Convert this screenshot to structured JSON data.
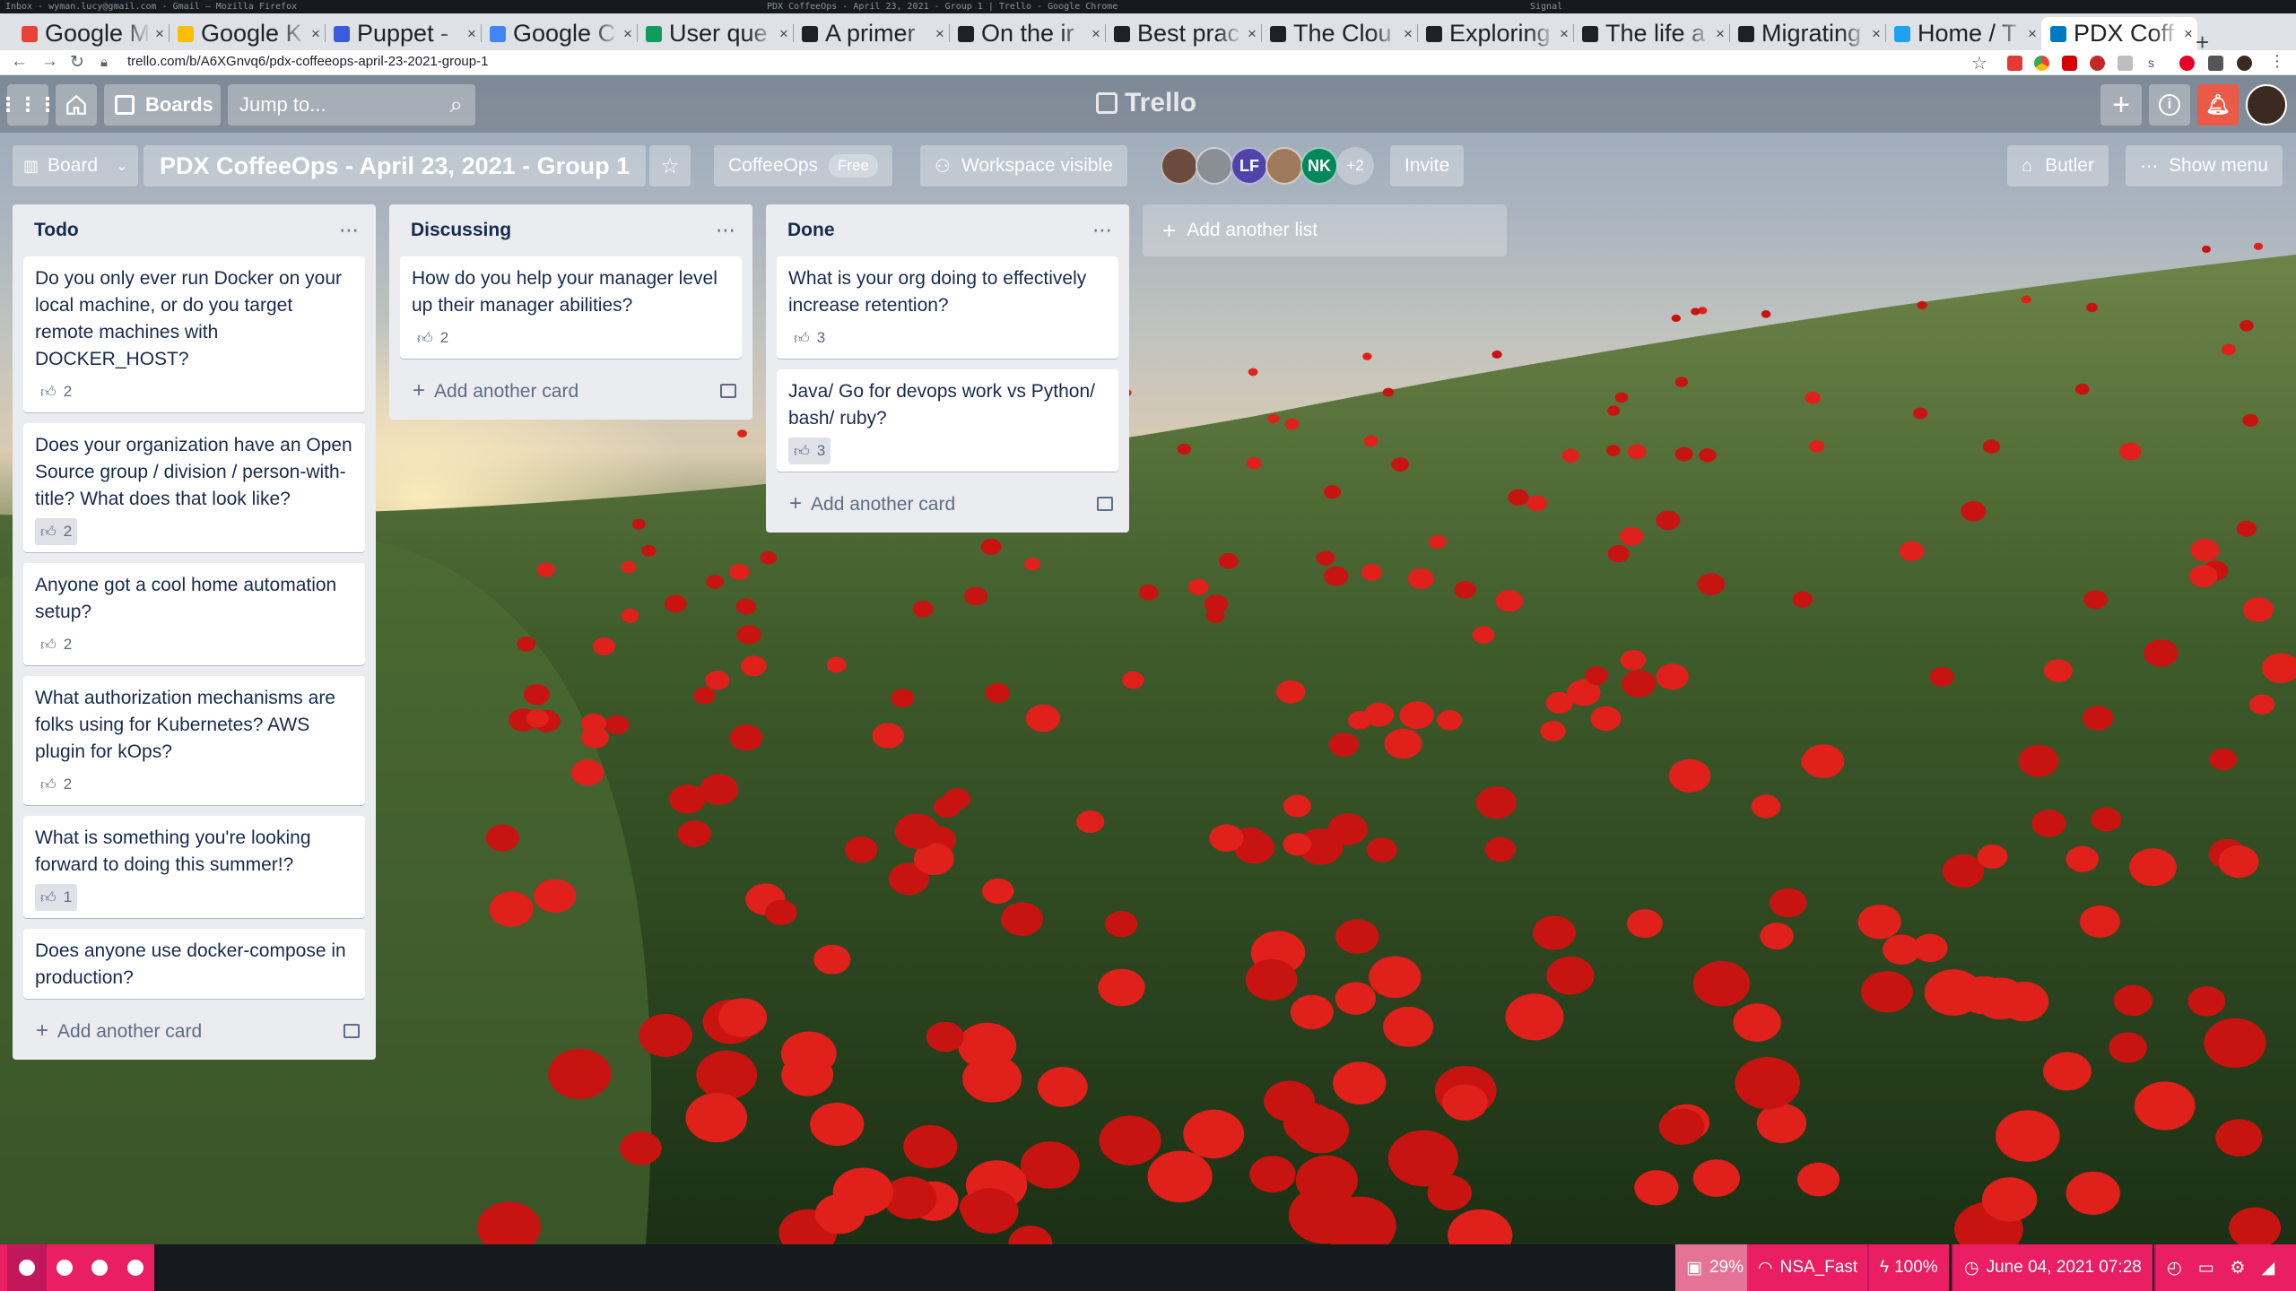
{
  "os_top": {
    "left_text": "Inbox - wyman.lucy@gmail.com - Gmail — Mozilla Firefox",
    "center_text": "PDX CoffeeOps - April 23, 2021 - Group 1 | Trello - Google Chrome",
    "right_text": "Signal"
  },
  "tabs": [
    {
      "title": "Google M",
      "fav_color": "#ea4335"
    },
    {
      "title": "Google K",
      "fav_color": "#fbbc04"
    },
    {
      "title": "Puppet - ",
      "fav_color": "#3b5bdb"
    },
    {
      "title": "Google C",
      "fav_color": "#4285f4"
    },
    {
      "title": "User que",
      "fav_color": "#0f9d58"
    },
    {
      "title": "A primer",
      "fav_color": "#202124"
    },
    {
      "title": "On the ir",
      "fav_color": "#202124"
    },
    {
      "title": "Best prac",
      "fav_color": "#202124"
    },
    {
      "title": "The Clou",
      "fav_color": "#202124"
    },
    {
      "title": "Exploring",
      "fav_color": "#202124"
    },
    {
      "title": "The life a",
      "fav_color": "#202124"
    },
    {
      "title": "Migrating",
      "fav_color": "#202124"
    },
    {
      "title": "Home / T",
      "fav_color": "#1da1f2"
    },
    {
      "title": "PDX Coff",
      "fav_color": "#0079bf"
    }
  ],
  "new_tab": "+",
  "address": "trello.com/b/A6XGnvq6/pdx-coffeeops-april-23-2021-group-1",
  "trello_header": {
    "boards": "Boards",
    "search_placeholder": "Jump to...",
    "logo": "Trello"
  },
  "board": {
    "view": "Board",
    "title": "PDX CoffeeOps - April 23, 2021 - Group 1",
    "workspace": "CoffeeOps",
    "plan": "Free",
    "visibility": "Workspace visible",
    "members": [
      {
        "initials": "",
        "color": "#6b4b3e"
      },
      {
        "initials": "",
        "color": "#8a8f96"
      },
      {
        "initials": "LF",
        "color": "#5243aa"
      },
      {
        "initials": "",
        "color": "#a07a5c"
      },
      {
        "initials": "NK",
        "color": "#00875a"
      }
    ],
    "more_members": "+2",
    "invite": "Invite",
    "butler": "Butler",
    "show_menu": "Show menu",
    "add_list": "Add another list"
  },
  "add_card_label": "Add another card",
  "lists": [
    {
      "title": "Todo",
      "cards": [
        {
          "text": "Do you only ever run Docker on your local machine, or do you target remote machines with DOCKER_HOST?",
          "votes": "2",
          "voted": false
        },
        {
          "text": "Does your organization have an Open Source group / division / person-with-title? What does that look like?",
          "votes": "2",
          "voted": true
        },
        {
          "text": "Anyone got a cool home automation setup?",
          "votes": "2",
          "voted": false
        },
        {
          "text": "What authorization mechanisms are folks using for Kubernetes? AWS plugin for kOps?",
          "votes": "2",
          "voted": false
        },
        {
          "text": "What is something you're looking forward to doing this summer!?",
          "votes": "1",
          "voted": true
        },
        {
          "text": "Does anyone use docker-compose in production?",
          "votes": "",
          "voted": false
        }
      ]
    },
    {
      "title": "Discussing",
      "cards": [
        {
          "text": "How do you help your manager level up their manager abilities?",
          "votes": "2",
          "voted": false
        }
      ]
    },
    {
      "title": "Done",
      "cards": [
        {
          "text": "What is your org doing to effectively increase retention?",
          "votes": "3",
          "voted": false
        },
        {
          "text": "Java/ Go for devops work vs Python/ bash/ ruby?",
          "votes": "3",
          "voted": true
        }
      ]
    }
  ],
  "status_bar": {
    "disk": "29%",
    "wifi": "NSA_Fast",
    "battery": "100%",
    "datetime": "June 04, 2021 07:28"
  },
  "colors": {
    "trello_blue": "#0079bf",
    "list_bg": "#ebecf0",
    "notification_red": "#eb5a46",
    "workspace_pink": "#e91e63"
  }
}
